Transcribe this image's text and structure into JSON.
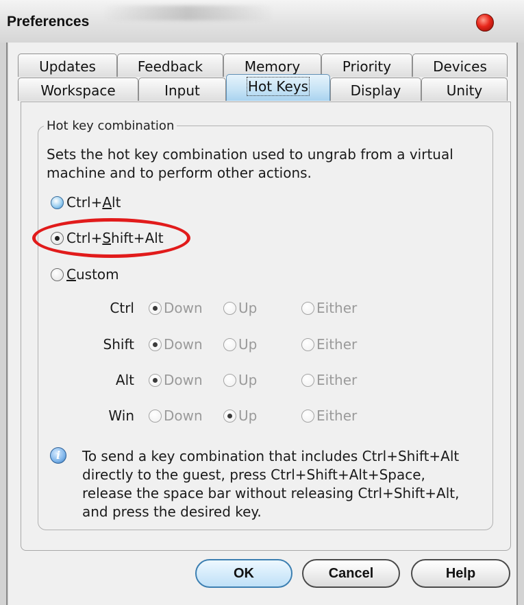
{
  "window": {
    "title": "Preferences"
  },
  "tabs": {
    "back_row": [
      {
        "label": "Updates"
      },
      {
        "label": "Feedback"
      },
      {
        "label": "Memory"
      },
      {
        "label": "Priority"
      },
      {
        "label": "Devices"
      }
    ],
    "front_row": [
      {
        "label": "Workspace"
      },
      {
        "label": "Input"
      },
      {
        "label": "Hot Keys",
        "active": true
      },
      {
        "label": "Display"
      },
      {
        "label": "Unity"
      }
    ]
  },
  "hotkeys": {
    "group_title": "Hot key combination",
    "description": "Sets the hot key combination used to ungrab from a virtual machine and to perform other actions.",
    "options": {
      "ctrl_alt": {
        "prefix": "Ctrl+",
        "accel": "A",
        "suffix": "lt",
        "checked": false
      },
      "ctrl_shift_alt": {
        "prefix": "Ctrl+",
        "accel": "S",
        "suffix": "hift+Alt",
        "checked": true
      },
      "custom": {
        "prefix": "",
        "accel": "C",
        "suffix": "ustom",
        "checked": false
      }
    },
    "custom": {
      "option_labels": {
        "down": "Down",
        "up": "Up",
        "either": "Either"
      },
      "rows": [
        {
          "key": "Ctrl",
          "selected": "down"
        },
        {
          "key": "Shift",
          "selected": "down"
        },
        {
          "key": "Alt",
          "selected": "down"
        },
        {
          "key": "Win",
          "selected": "up"
        }
      ]
    },
    "info_text": "To send a key combination that includes Ctrl+Shift+Alt directly to the guest, press Ctrl+Shift+Alt+Space, release the space bar without releasing Ctrl+Shift+Alt, and press the desired key."
  },
  "buttons": {
    "ok": "OK",
    "cancel": "Cancel",
    "help": "Help"
  },
  "icons": {
    "close": "close-orb-icon",
    "info": "info-icon"
  },
  "colors": {
    "highlight_ring": "#e11b1b",
    "active_tab": "#c4e2f5",
    "close_orb": "#e8271b"
  }
}
